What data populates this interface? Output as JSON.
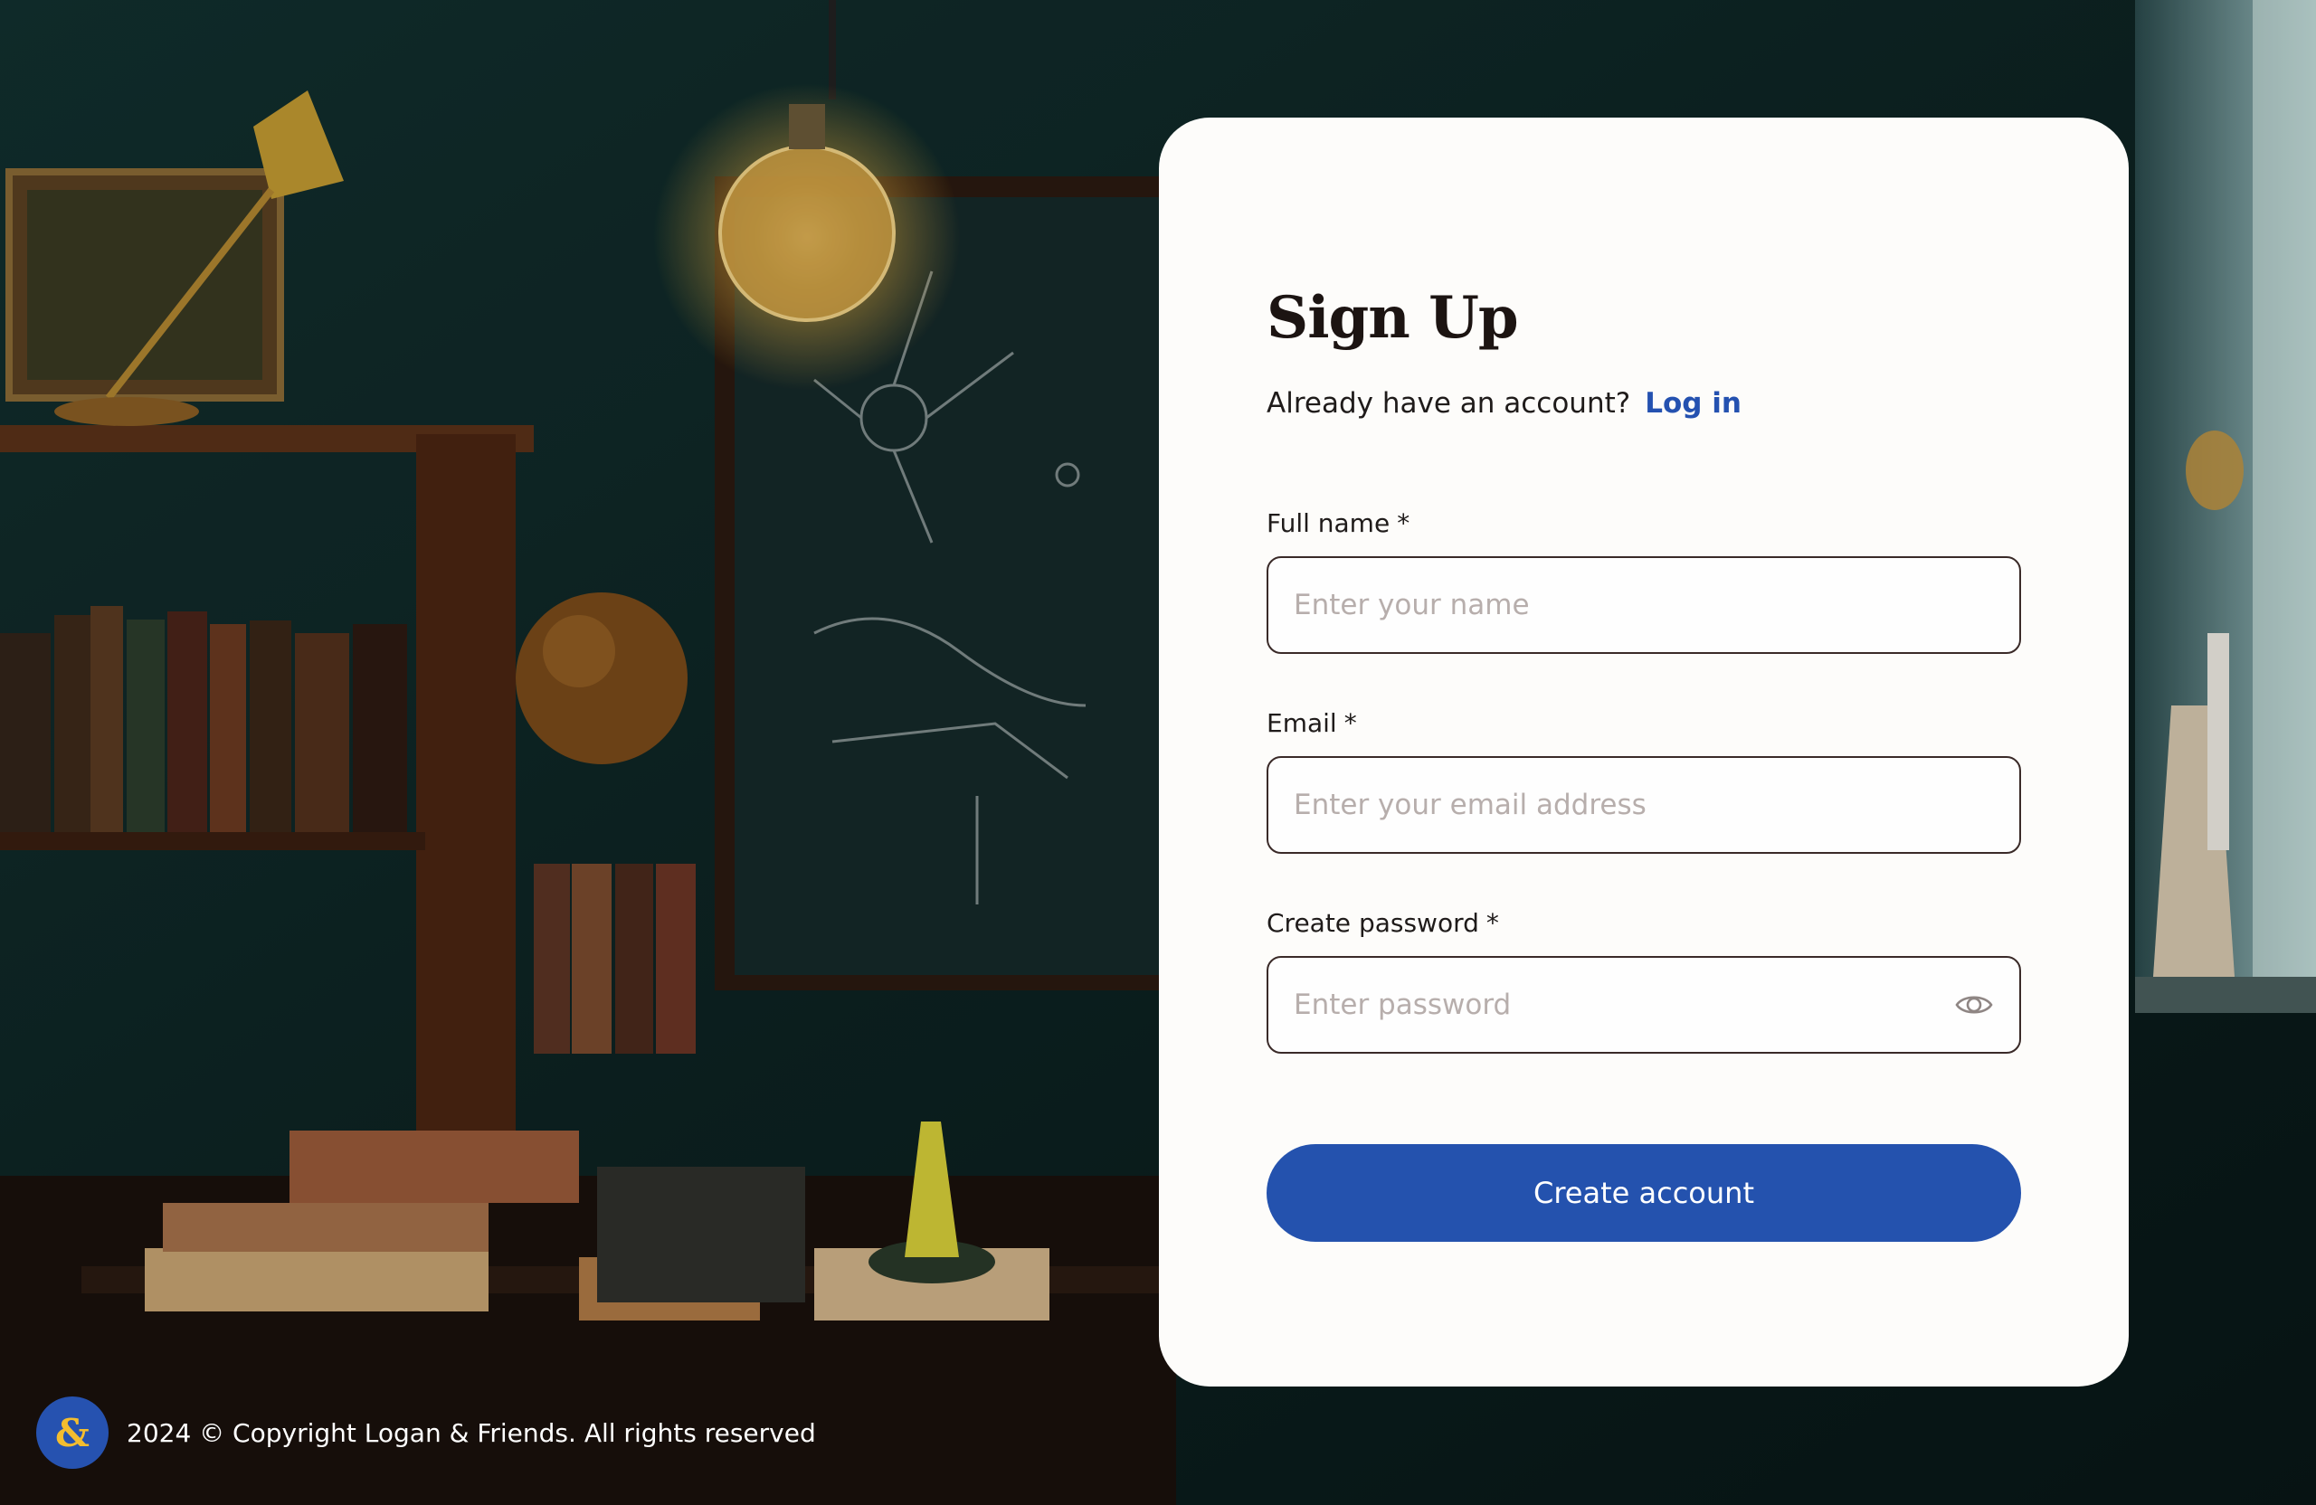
{
  "background": {
    "description_icon": "study-room-photo"
  },
  "signup": {
    "title": "Sign Up",
    "already_text": "Already have an account?",
    "login_link": "Log in",
    "fields": {
      "name": {
        "label": "Full name",
        "required_mark": "*",
        "placeholder": "Enter your name",
        "value": ""
      },
      "email": {
        "label": "Email",
        "required_mark": "*",
        "placeholder": "Enter your email address",
        "value": ""
      },
      "password": {
        "label": "Create password",
        "required_mark": "*",
        "placeholder": "Enter password",
        "value": "",
        "toggle_icon": "eye-icon"
      }
    },
    "submit_label": "Create account"
  },
  "footer": {
    "logo_glyph": "&",
    "copyright": "2024 © Copyright Logan & Friends. All rights reserved"
  },
  "colors": {
    "accent": "#2452ae",
    "link": "#2451b0",
    "card": "#fdfcfa",
    "logo_glyph": "#f3bd2f"
  }
}
